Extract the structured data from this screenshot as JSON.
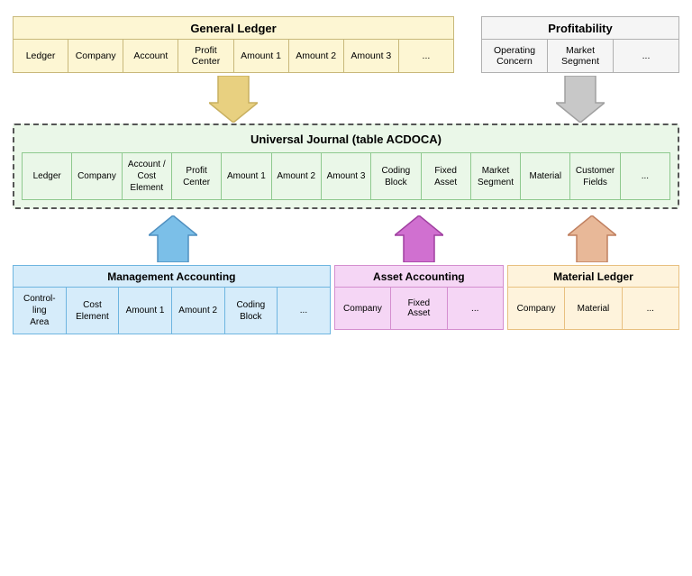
{
  "general_ledger": {
    "title": "General Ledger",
    "columns": [
      "Ledger",
      "Company",
      "Account",
      "Profit\nCenter",
      "Amount 1",
      "Amount 2",
      "Amount 3",
      "..."
    ]
  },
  "profitability": {
    "title": "Profitability",
    "columns": [
      "Operating\nConcern",
      "Market\nSegment",
      "..."
    ]
  },
  "universal_journal": {
    "title": "Universal Journal  (table ACDOCA)",
    "columns": [
      "Ledger",
      "Company",
      "Account /\nCost\nElement",
      "Profit\nCenter",
      "Amount 1",
      "Amount 2",
      "Amount 3",
      "Coding\nBlock",
      "Fixed\nAsset",
      "Market\nSegment",
      "Material",
      "Customer\nFields",
      "..."
    ]
  },
  "management_accounting": {
    "title": "Management Accounting",
    "columns": [
      "Control-\ning\nArea",
      "Cost\nElement",
      "Amount 1",
      "Amount 2",
      "Coding\nBlock",
      "..."
    ]
  },
  "asset_accounting": {
    "title": "Asset Accounting",
    "columns": [
      "Company",
      "Fixed\nAsset",
      "..."
    ]
  },
  "material_ledger": {
    "title": "Material Ledger",
    "columns": [
      "Company",
      "Material",
      "..."
    ]
  },
  "arrows": {
    "gl_down_color": "#e8d080",
    "prof_down_color": "#b0b0b0",
    "ma_up_color": "#7bbfe8",
    "aa_up_color": "#d070d0",
    "ml_up_color": "#e8b898"
  }
}
